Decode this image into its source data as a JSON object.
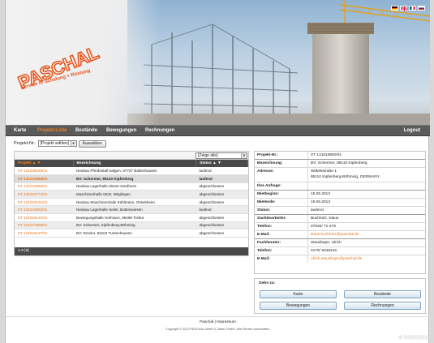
{
  "header": {
    "brand_name": "PASCHAL",
    "tagline": "Service in Schalung + Rüstung",
    "flags": [
      "de-flag",
      "uk-flag",
      "fr-flag",
      "ru-flag"
    ]
  },
  "nav": {
    "items": [
      "Karte",
      "Projekt-Liste",
      "Bestände",
      "Bewegungen",
      "Rechnungen"
    ],
    "logout": "Logout",
    "active_index": 1
  },
  "filter": {
    "label": "Projekt-Nr.:",
    "select_value": "[Projekt wählen]",
    "button": "Auswählen"
  },
  "table": {
    "view_select": "[Zeige alle]",
    "columns": [
      "Projekt ▲ ▼",
      "Bezeichnung",
      "Status ▲ ▼"
    ],
    "rows": [
      [
        "ST 121028093/01",
        "Neubau Pferdestall Salgen, 87727 Babenhausen",
        "laufend"
      ],
      [
        "ST 131010650/01",
        "BV: Schermer, 85110 Kipfenberg",
        "laufend"
      ],
      [
        "ST 131010652/01",
        "Neubau Lagerhalle Zinner Nordheim",
        "abgeschlossen"
      ],
      [
        "ST 131010774/01",
        "Maschinenhalle Motz, Möglingen",
        "abgeschlossen"
      ],
      [
        "ST 131010231/01",
        "Neubau Maschinenhalle Kühlmann, Ostelsheim",
        "abgeschlossen"
      ],
      [
        "ST 131010802/01",
        "Neubau Lagerhalle Seiler, Buttenwiesen",
        "laufend"
      ],
      [
        "ST 121010140/01",
        "Bewegungshalle Hofmann, 65468 Trebur",
        "abgeschlossen"
      ],
      [
        "ST 121017886/01",
        "BV: Schermer, Kipfenberg-Böhming",
        "abgeschlossen"
      ],
      [
        "ST 121010137/01",
        "BV: Drexler, 83104 Tuntenhausen",
        "abgeschlossen"
      ]
    ],
    "pager": "1-9 [9]"
  },
  "detail": {
    "rows": [
      {
        "k": "Projekt-Nr.:",
        "v": "ST 131010650/01"
      },
      {
        "k": "Bezeichnung:",
        "v": "BV: Schermer, 85110 Kipfenberg"
      },
      {
        "k": "Adresse:",
        "v": "Wittelsstraße 1",
        "v2": "85110 Kipfenberg-Böhming, GERMANY"
      },
      {
        "k": "Ihre Anfrage:",
        "v": ""
      },
      {
        "k": "Mietbeginn:",
        "v": "15.05.2013"
      },
      {
        "k": "Mietende:",
        "v": "15.06.2013"
      },
      {
        "k": "Status:",
        "v": "laufend"
      },
      {
        "k": "Sachbearbeiter:",
        "v": "Buchholz, Klaus"
      },
      {
        "k": "Telefon:",
        "v": "07832/ 71-278"
      },
      {
        "k": "E-Mail:",
        "v": "klaus.buchholz@paschal.de"
      },
      {
        "k": "Fachberater:",
        "v": "Staudinger, Ulrich"
      },
      {
        "k": "Telefon:",
        "v": "0179/ 9348216"
      },
      {
        "k": "E-Mail:",
        "v": "ulrich.staudinger@paschal.de"
      }
    ]
  },
  "goto": {
    "title": "Gehe zu:",
    "buttons": [
      "Karte",
      "Bestände",
      "Bewegungen",
      "Rechnungen"
    ]
  },
  "footer": {
    "link1": "Paschal",
    "sep": "|",
    "link2": "Impressum",
    "copyright": "Copyright © 2013 PASCHAL-Werk G. Maier GmbH. Alle Rechte vorbehalten.",
    "watermark": "© PASCHAL"
  },
  "colors": {
    "accent": "#e8731c",
    "nav_bg": "#5b5b5b",
    "table_head": "#4a4a4a"
  }
}
